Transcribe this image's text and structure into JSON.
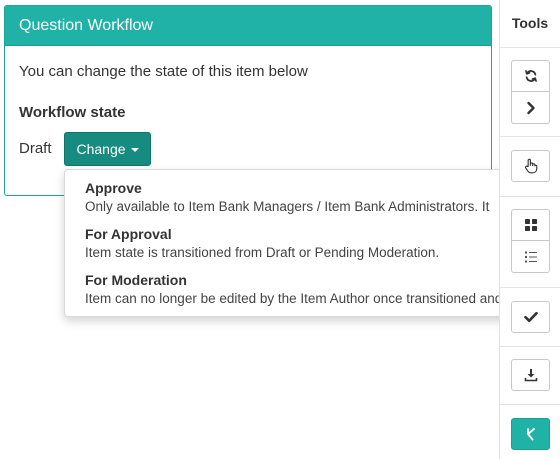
{
  "panel": {
    "title": "Question Workflow",
    "description": "You can change the state of this item below",
    "subheading": "Workflow state",
    "state_value": "Draft",
    "change_label": "Change"
  },
  "dropdown": {
    "items": [
      {
        "title": "Approve",
        "description": "Only available to Item Bank Managers / Item Bank Administrators. It"
      },
      {
        "title": "For Approval",
        "description": "Item state is transitioned from Draft or Pending Moderation."
      },
      {
        "title": "For Moderation",
        "description": "Item can no longer be edited by the Item Author once transitioned and"
      }
    ]
  },
  "tools": {
    "title": "Tools",
    "buttons": [
      {
        "icon": "refresh-icon"
      },
      {
        "icon": "chevron-right-icon"
      },
      {
        "icon": "pointer-hand-icon"
      },
      {
        "icon": "grid-icon"
      },
      {
        "icon": "list-icon"
      },
      {
        "icon": "check-icon"
      },
      {
        "icon": "download-icon"
      },
      {
        "icon": "workflow-icon"
      }
    ]
  },
  "colors": {
    "header": "#20b2a6",
    "change_button": "#168c80",
    "active_tool": "#20b2a6"
  }
}
